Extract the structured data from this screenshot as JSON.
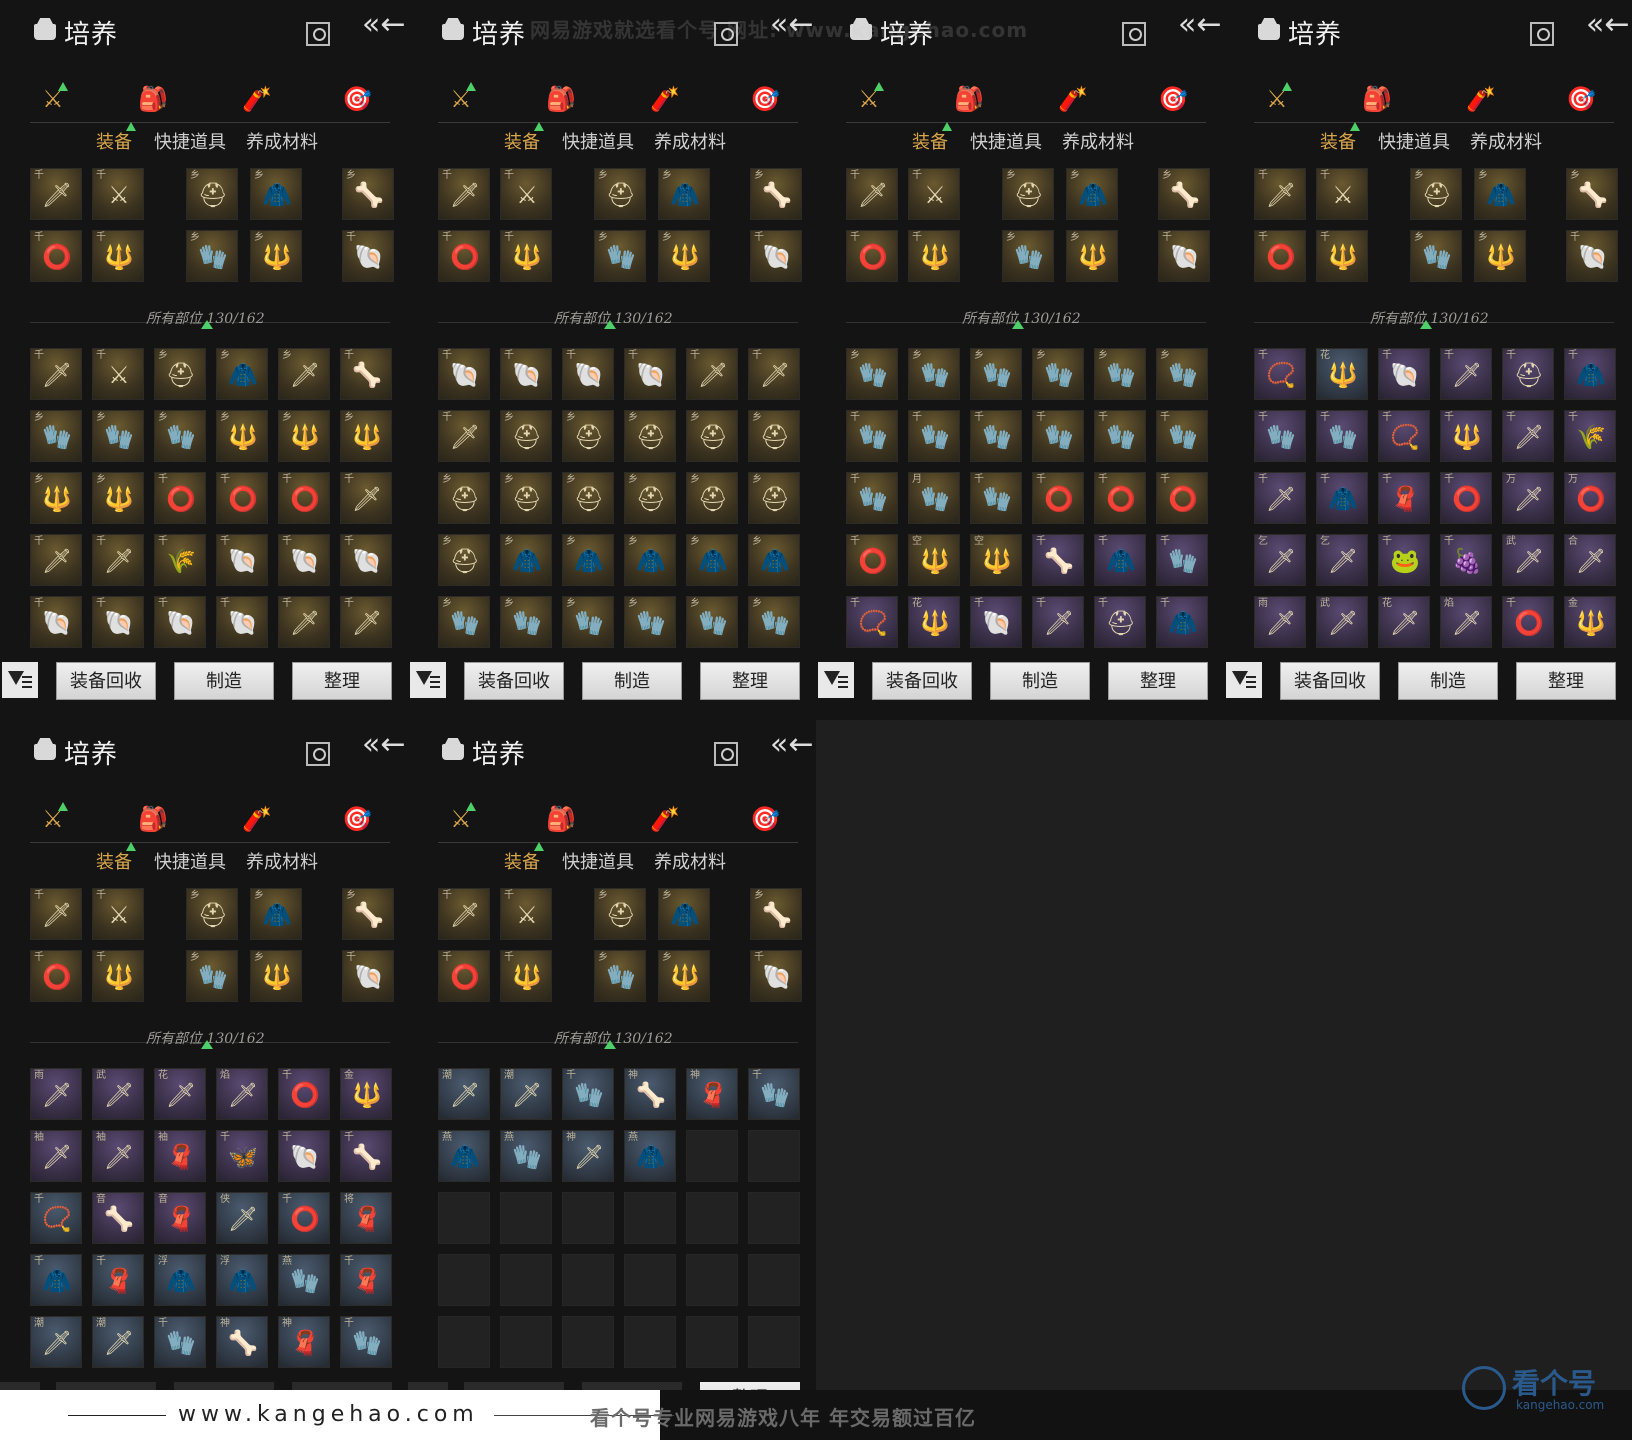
{
  "panel": {
    "title": "培养",
    "tabs": [
      "装备",
      "快捷道具",
      "养成材料"
    ],
    "parts_label": "所有部位 130/162",
    "buttons": [
      "装备回收",
      "制造",
      "整理"
    ]
  },
  "panels": [
    {
      "rows": [
        [
          "gold:千:🗡",
          "gold:千:⚔",
          "gold:乡:⛑",
          "gold:乡:🧥",
          "gold:乡:🗡",
          "gold:千:🦴"
        ],
        [
          "gold:乡:🧤",
          "gold:乡:🧤",
          "gold:乡:🧤",
          "gold:乡:🔱",
          "gold:乡:🔱",
          "gold:乡:🔱"
        ],
        [
          "gold:乡:🔱",
          "gold:乡:🔱",
          "gold:千:⭕",
          "gold:千:⭕",
          "gold:千:⭕",
          "gold:千:🗡"
        ],
        [
          "gold:千:🗡",
          "gold:千:🗡",
          "gold:千:🌾",
          "gold:千:🐚",
          "gold:千:🐚",
          "gold:千:🐚"
        ],
        [
          "gold:千:🐚",
          "gold:千:🐚",
          "gold:千:🐚",
          "gold:千:🐚",
          "gold:千:🗡",
          "gold:千:🗡"
        ]
      ]
    },
    {
      "rows": [
        [
          "gold:千:🐚",
          "gold:千:🐚",
          "gold:千:🐚",
          "gold:千:🐚",
          "gold:千:🗡",
          "gold:千:🗡"
        ],
        [
          "gold:千:🗡",
          "gold:乡:⛑",
          "gold:乡:⛑",
          "gold:乡:⛑",
          "gold:乡:⛑",
          "gold:乡:⛑"
        ],
        [
          "gold:乡:⛑",
          "gold:乡:⛑",
          "gold:乡:⛑",
          "gold:乡:⛑",
          "gold:乡:⛑",
          "gold:乡:⛑"
        ],
        [
          "gold:乡:⛑",
          "gold:乡:🧥",
          "gold:乡:🧥",
          "gold:乡:🧥",
          "gold:乡:🧥",
          "gold:乡:🧥"
        ],
        [
          "gold:乡:🧤",
          "gold:乡:🧤",
          "gold:乡:🧤",
          "gold:乡:🧤",
          "gold:乡:🧤",
          "gold:乡:🧤"
        ]
      ]
    },
    {
      "rows": [
        [
          "gold:乡:🧤",
          "gold:乡:🧤",
          "gold:乡:🧤",
          "gold:乡:🧤",
          "gold:乡:🧤",
          "gold:乡:🧤"
        ],
        [
          "gold:千:🧤",
          "gold:千:🧤",
          "gold:千:🧤",
          "gold:千:🧤",
          "gold:千:🧤",
          "gold:千:🧤"
        ],
        [
          "gold:千:🧤",
          "gold:月:🧤",
          "gold:千:🧤",
          "gold:千:⭕",
          "gold:千:⭕",
          "gold:千:⭕"
        ],
        [
          "gold:千:⭕",
          "gold:空:🔱",
          "gold:空:🔱",
          "purple:千:🦴",
          "purple:千:🧥",
          "purple:千:🧤"
        ],
        [
          "purple:千:📿",
          "purple:花:🔱",
          "purple:千:🐚",
          "purple:千:🗡",
          "purple:千:⛑",
          "purple:千:🧥"
        ]
      ]
    },
    {
      "rows": [
        [
          "purple:千:📿",
          "blue:花:🔱",
          "purple:千:🐚",
          "purple:千:🗡",
          "purple:千:⛑",
          "purple:千:🧥"
        ],
        [
          "purple:千:🧤",
          "purple:千:🧤",
          "purple:千:📿",
          "purple:千:🔱",
          "purple:千:🗡",
          "purple:千:🌾"
        ],
        [
          "purple:千:🗡",
          "purple:千:🧥",
          "purple:千:🧣",
          "purple:千:⭕",
          "purple:万:🗡",
          "purple:万:⭕"
        ],
        [
          "purple:乞:🗡",
          "purple:乞:🗡",
          "purple:千:🐸",
          "purple:千:🍇",
          "purple:武:🗡",
          "purple:合:🗡"
        ],
        [
          "purple:雨:🗡",
          "purple:武:🗡",
          "purple:花:🗡",
          "purple:焰:🗡",
          "purple:千:⭕",
          "purple:金:🔱"
        ]
      ]
    },
    {
      "rows": [
        [
          "purple:雨:🗡",
          "purple:武:🗡",
          "purple:花:🗡",
          "purple:焰:🗡",
          "purple:千:⭕",
          "purple:金:🔱"
        ],
        [
          "purple:袖:🗡",
          "purple:袖:🗡",
          "purple:袖:🧣",
          "purple:千:🦋",
          "purple:千:🐚",
          "purple:千:🦴"
        ],
        [
          "blue:千:📿",
          "purple:音:🦴",
          "purple:音:🧣",
          "blue:侠:🗡",
          "blue:千:⭕",
          "blue:将:🧣"
        ],
        [
          "blue:千:🧥",
          "blue:千:🧣",
          "blue:浮:🧥",
          "blue:浮:🧥",
          "blue:燕:🧤",
          "blue:千:🧣"
        ],
        [
          "blue:潮:🗡",
          "blue:潮:🗡",
          "blue:千:🧤",
          "blue:神:🦴",
          "blue:神:🧣",
          "blue:千:🧤"
        ]
      ]
    },
    {
      "rows": [
        [
          "blue:潮:🗡",
          "blue:潮:🗡",
          "blue:千:🧤",
          "blue:神:🦴",
          "blue:神:🧣",
          "blue:千:🧤"
        ],
        [
          "blue:燕:🧥",
          "blue:燕:🧤",
          "blue:神:🗡",
          "blue:燕:🧥",
          "empty::",
          "empty::"
        ],
        [
          "empty::",
          "empty::",
          "empty::",
          "empty::",
          "empty::",
          "empty::"
        ],
        [
          "empty::",
          "empty::",
          "empty::",
          "empty::",
          "empty::",
          "empty::"
        ],
        [
          "empty::",
          "empty::",
          "empty::",
          "empty::",
          "empty::",
          "empty::"
        ]
      ]
    }
  ],
  "equipped": [
    [
      "gold:千:🗡",
      "gold:千:⚔",
      "gap",
      "gold:乡:⛑",
      "gold:乡:🧥",
      "gap",
      "gold:乡:🦴"
    ],
    [
      "gold:千:⭕",
      "gold:千:🔱",
      "gap",
      "gold:乡:🧤",
      "gold:乡:🔱",
      "gap",
      "gold:千:🐚"
    ]
  ],
  "icons": {
    "cat1": "⚔",
    "cat2": "🎒",
    "cat3": "🧨",
    "cat4": "🎯",
    "back": "«←"
  },
  "watermarks": {
    "top": "网易游戏就选看个号 网址: www.kangehao.com"
  },
  "footer": {
    "url": "www.kangehao.com",
    "slogan": "看个号专业网易游戏八年  年交易额过百亿",
    "logo_text": "看个号",
    "logo_sub": "kangehao.com",
    "ghost_btn": "整理"
  }
}
